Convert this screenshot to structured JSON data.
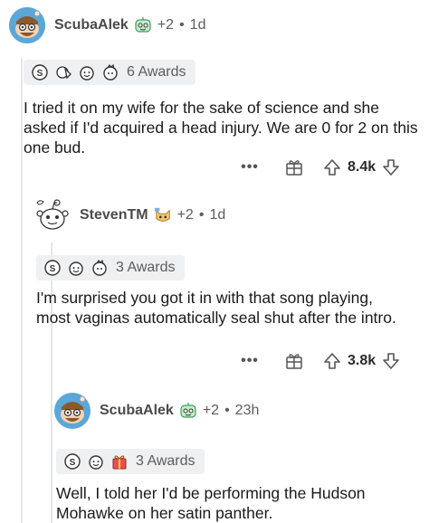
{
  "comments": [
    {
      "username": "ScubaAlek",
      "plus": "+2",
      "time": "1d",
      "awards_label": "6 Awards",
      "body": "I tried it on my wife for the sake of science and she asked if I'd acquired a head injury. We are 0 for 2 on this one bud.",
      "score": "8.4k",
      "avatar_icon": "snoo-avatar-icon",
      "flair_icon": "robot-face-icon"
    },
    {
      "username": "StevenTM",
      "plus": "+2",
      "time": "1d",
      "awards_label": "3 Awards",
      "body": "I'm surprised you got it in with that song playing, most vaginas automatically seal shut after the intro.",
      "score": "3.8k",
      "avatar_icon": "snoo-avatar-icon",
      "flair_icon": "cat-face-icon"
    },
    {
      "username": "ScubaAlek",
      "plus": "+2",
      "time": "23h",
      "awards_label": "3 Awards",
      "body": "Well, I told her I'd be performing the Hudson Mohawke on her satin panther.",
      "avatar_icon": "snoo-avatar-icon",
      "flair_icon": "robot-face-icon"
    }
  ],
  "separator": "•",
  "colors": {
    "thread_line": "#e4e6e8",
    "award_bg": "#eef0f1",
    "avatar_bg": "#5aa7d8",
    "text": "#1a1a1b",
    "meta": "#5c5c5e"
  }
}
